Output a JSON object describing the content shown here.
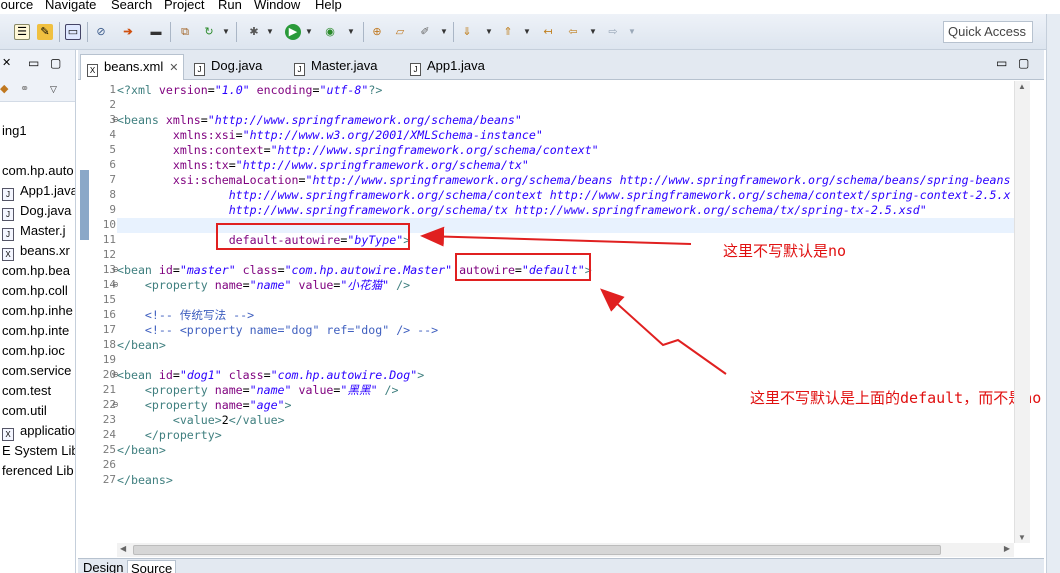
{
  "menu": [
    "Source",
    "Navigate",
    "Search",
    "Project",
    "Run",
    "Window",
    "Help"
  ],
  "toolbar": {
    "quick_access_label": "Quick Access"
  },
  "package_explorer": {
    "items": [
      {
        "label": "ing1",
        "icon": "project-icon"
      },
      {
        "label": "com.hp.auto",
        "icon": "package-icon"
      },
      {
        "label": "App1.java",
        "icon": "java-file-icon"
      },
      {
        "label": "Dog.java",
        "icon": "java-file-icon"
      },
      {
        "label": "Master.j",
        "icon": "java-file-icon"
      },
      {
        "label": "beans.xr",
        "icon": "xml-file-icon"
      },
      {
        "label": "com.hp.bea",
        "icon": "package-icon"
      },
      {
        "label": "com.hp.coll",
        "icon": "package-icon"
      },
      {
        "label": "com.hp.inhe",
        "icon": "package-icon"
      },
      {
        "label": "com.hp.inte",
        "icon": "package-icon"
      },
      {
        "label": "com.hp.ioc",
        "icon": "package-icon"
      },
      {
        "label": "com.service",
        "icon": "package-icon"
      },
      {
        "label": "com.test",
        "icon": "package-icon"
      },
      {
        "label": "com.util",
        "icon": "package-icon"
      },
      {
        "label": "application(",
        "icon": "xml-file-icon"
      },
      {
        "label": "E System Lib",
        "icon": "library-icon"
      },
      {
        "label": "ferenced Lib",
        "icon": "library-icon"
      }
    ]
  },
  "editor": {
    "tabs": [
      {
        "label": "beans.xml",
        "icon": "X",
        "active": true,
        "close": "✕"
      },
      {
        "label": "Dog.java",
        "icon": "J",
        "active": false
      },
      {
        "label": "Master.java",
        "icon": "J",
        "active": false
      },
      {
        "label": "App1.java",
        "icon": "J",
        "active": false
      }
    ],
    "line_numbers": [
      "1",
      "2",
      "3",
      "4",
      "5",
      "6",
      "7",
      "8",
      "9",
      "10",
      "11",
      "12",
      "13",
      "14",
      "15",
      "16",
      "17",
      "18",
      "19",
      "20",
      "21",
      "22",
      "23",
      "24",
      "25",
      "26",
      "27"
    ],
    "code_lines": [
      {
        "n": 1,
        "tokens": [
          [
            "pi",
            "<?"
          ],
          [
            "tag",
            "xml"
          ],
          [
            "text",
            " "
          ],
          [
            "attr",
            "version"
          ],
          [
            "text",
            "="
          ],
          [
            "val",
            "\"1.0\""
          ],
          [
            "text",
            " "
          ],
          [
            "attr",
            "encoding"
          ],
          [
            "text",
            "="
          ],
          [
            "val",
            "\"utf-8\""
          ],
          [
            "pi",
            "?>"
          ]
        ]
      },
      {
        "n": 2,
        "tokens": []
      },
      {
        "n": 3,
        "tokens": [
          [
            "tag",
            "<beans"
          ],
          [
            "text",
            " "
          ],
          [
            "attr",
            "xmlns"
          ],
          [
            "text",
            "="
          ],
          [
            "val",
            "\"http://www.springframework.org/schema/beans\""
          ]
        ]
      },
      {
        "n": 4,
        "tokens": [
          [
            "text",
            "        "
          ],
          [
            "attr",
            "xmlns:xsi"
          ],
          [
            "text",
            "="
          ],
          [
            "val",
            "\"http://www.w3.org/2001/XMLSchema-instance\""
          ]
        ]
      },
      {
        "n": 5,
        "tokens": [
          [
            "text",
            "        "
          ],
          [
            "attr",
            "xmlns:context"
          ],
          [
            "text",
            "="
          ],
          [
            "val",
            "\"http://www.springframework.org/schema/context\""
          ]
        ]
      },
      {
        "n": 6,
        "tokens": [
          [
            "text",
            "        "
          ],
          [
            "attr",
            "xmlns:tx"
          ],
          [
            "text",
            "="
          ],
          [
            "val",
            "\"http://www.springframework.org/schema/tx\""
          ]
        ]
      },
      {
        "n": 7,
        "tokens": [
          [
            "text",
            "        "
          ],
          [
            "attr",
            "xsi:schemaLocation"
          ],
          [
            "text",
            "="
          ],
          [
            "val",
            "\"http://www.springframework.org/schema/beans http://www.springframework.org/schema/beans/spring-beans"
          ]
        ]
      },
      {
        "n": 8,
        "tokens": [
          [
            "text",
            "                "
          ],
          [
            "val",
            "http://www.springframework.org/schema/context http://www.springframework.org/schema/context/spring-context-2.5.x"
          ]
        ]
      },
      {
        "n": 9,
        "tokens": [
          [
            "text",
            "                "
          ],
          [
            "val",
            "http://www.springframework.org/schema/tx http://www.springframework.org/schema/tx/spring-tx-2.5.xsd\""
          ]
        ]
      },
      {
        "n": 10,
        "tokens": []
      },
      {
        "n": 11,
        "tokens": [
          [
            "text",
            "                "
          ],
          [
            "attr",
            "default-autowire"
          ],
          [
            "text",
            "="
          ],
          [
            "val",
            "\"byType\""
          ],
          [
            "tag",
            ">"
          ]
        ]
      },
      {
        "n": 12,
        "tokens": []
      },
      {
        "n": 13,
        "tokens": [
          [
            "tag",
            "<bean"
          ],
          [
            "text",
            " "
          ],
          [
            "attr",
            "id"
          ],
          [
            "text",
            "="
          ],
          [
            "val",
            "\"master\""
          ],
          [
            "text",
            " "
          ],
          [
            "attr",
            "class"
          ],
          [
            "text",
            "="
          ],
          [
            "val",
            "\"com.hp.autowire.Master\""
          ],
          [
            "text",
            " "
          ],
          [
            "attr",
            "autowire"
          ],
          [
            "text",
            "="
          ],
          [
            "val",
            "\"default\""
          ],
          [
            "tag",
            ">"
          ]
        ]
      },
      {
        "n": 14,
        "tokens": [
          [
            "text",
            "    "
          ],
          [
            "tag",
            "<property"
          ],
          [
            "text",
            " "
          ],
          [
            "attr",
            "name"
          ],
          [
            "text",
            "="
          ],
          [
            "val",
            "\"name\""
          ],
          [
            "text",
            " "
          ],
          [
            "attr",
            "value"
          ],
          [
            "text",
            "="
          ],
          [
            "val",
            "\"小花猫\""
          ],
          [
            "text",
            " "
          ],
          [
            "tag",
            "/>"
          ]
        ]
      },
      {
        "n": 15,
        "tokens": []
      },
      {
        "n": 16,
        "tokens": [
          [
            "text",
            "    "
          ],
          [
            "cmt",
            "<!-- 传统写法 -->"
          ]
        ]
      },
      {
        "n": 17,
        "tokens": [
          [
            "text",
            "    "
          ],
          [
            "cmt",
            "<!-- <property name=\"dog\" ref=\"dog\" /> -->"
          ]
        ]
      },
      {
        "n": 18,
        "tokens": [
          [
            "tag",
            "</bean>"
          ]
        ]
      },
      {
        "n": 19,
        "tokens": []
      },
      {
        "n": 20,
        "tokens": [
          [
            "tag",
            "<bean"
          ],
          [
            "text",
            " "
          ],
          [
            "attr",
            "id"
          ],
          [
            "text",
            "="
          ],
          [
            "val",
            "\"dog1\""
          ],
          [
            "text",
            " "
          ],
          [
            "attr",
            "class"
          ],
          [
            "text",
            "="
          ],
          [
            "val",
            "\"com.hp.autowire.Dog\""
          ],
          [
            "tag",
            ">"
          ]
        ]
      },
      {
        "n": 21,
        "tokens": [
          [
            "text",
            "    "
          ],
          [
            "tag",
            "<property"
          ],
          [
            "text",
            " "
          ],
          [
            "attr",
            "name"
          ],
          [
            "text",
            "="
          ],
          [
            "val",
            "\"name\""
          ],
          [
            "text",
            " "
          ],
          [
            "attr",
            "value"
          ],
          [
            "text",
            "="
          ],
          [
            "val",
            "\"黑黑\""
          ],
          [
            "text",
            " "
          ],
          [
            "tag",
            "/>"
          ]
        ]
      },
      {
        "n": 22,
        "tokens": [
          [
            "text",
            "    "
          ],
          [
            "tag",
            "<property"
          ],
          [
            "text",
            " "
          ],
          [
            "attr",
            "name"
          ],
          [
            "text",
            "="
          ],
          [
            "val",
            "\"age\""
          ],
          [
            "tag",
            ">"
          ]
        ]
      },
      {
        "n": 23,
        "tokens": [
          [
            "text",
            "        "
          ],
          [
            "tag",
            "<value>"
          ],
          [
            "text",
            "2"
          ],
          [
            "tag",
            "</value>"
          ]
        ]
      },
      {
        "n": 24,
        "tokens": [
          [
            "text",
            "    "
          ],
          [
            "tag",
            "</property>"
          ]
        ]
      },
      {
        "n": 25,
        "tokens": [
          [
            "tag",
            "</bean>"
          ]
        ]
      },
      {
        "n": 26,
        "tokens": []
      },
      {
        "n": 27,
        "tokens": [
          [
            "tag",
            "</beans>"
          ]
        ]
      }
    ],
    "bottom_tabs": [
      "Design",
      "Source"
    ]
  },
  "annotations": {
    "note1": "这里不写默认是no",
    "note2": "这里不写默认是上面的default，而不是no"
  },
  "colors": {
    "annotation_red": "#e02020",
    "xml_tag": "#3f7f7f",
    "xml_attr": "#7f007f",
    "xml_value": "#2a00ff",
    "xml_comment": "#3f5fbf"
  }
}
